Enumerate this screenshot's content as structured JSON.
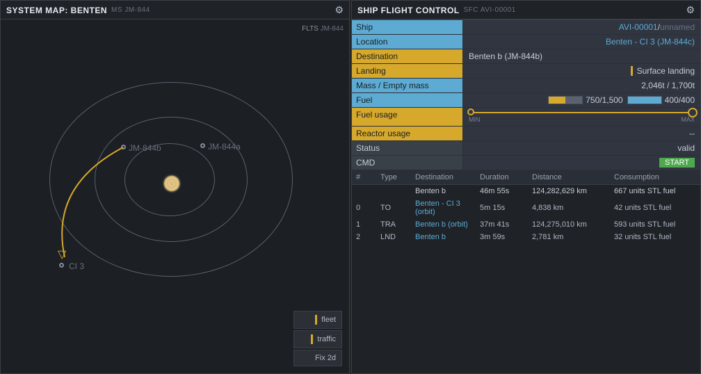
{
  "systemMap": {
    "title": "SYSTEM MAP: BENTEN",
    "sub": "MS JM-844",
    "fltsLabel": "FLTS",
    "fltsVal": "JM-844",
    "bodies": {
      "a": "JM-844a",
      "b": "JM-844b",
      "ci3": "CI 3"
    },
    "toggles": {
      "fleet": "fleet",
      "traffic": "traffic",
      "fix2d": "Fix 2d"
    }
  },
  "flight": {
    "title": "SHIP FLIGHT CONTROL",
    "sub": "SFC AVI-00001",
    "rows": {
      "shipLabel": "Ship",
      "shipId": "AVI-00001",
      "shipSep": " / ",
      "shipName": "unnamed",
      "locLabel": "Location",
      "locVal": "Benten - CI 3 (JM-844c)",
      "destLabel": "Destination",
      "destVal": "Benten b (JM-844b)",
      "landLabel": "Landing",
      "landVal": "Surface landing",
      "massLabel": "Mass / Empty mass",
      "massVal": "2,046t / 1,700t",
      "fuelLabel": "Fuel",
      "fuel1": "750/1,500",
      "fuel2": "400/400",
      "usageLabel": "Fuel usage",
      "usageMin": "MIN",
      "usageMax": "MAX",
      "reactorLabel": "Reactor usage",
      "reactorVal": "--",
      "statusLabel": "Status",
      "statusVal": "valid",
      "cmdLabel": "CMD",
      "cmdBtn": "START"
    },
    "tableHeaders": {
      "idx": "#",
      "type": "Type",
      "dest": "Destination",
      "dur": "Duration",
      "dist": "Distance",
      "cons": "Consumption"
    },
    "routes": [
      {
        "idx": "",
        "type": "",
        "dest": "Benten b",
        "dur": "46m 55s",
        "dist": "124,282,629 km",
        "cons": "667 units STL fuel",
        "summary": true
      },
      {
        "idx": "0",
        "type": "TO",
        "dest": "Benten - CI 3 (orbit)",
        "dur": "5m 15s",
        "dist": "4,838 km",
        "cons": "42 units STL fuel"
      },
      {
        "idx": "1",
        "type": "TRA",
        "dest": "Benten b (orbit)",
        "dur": "37m 41s",
        "dist": "124,275,010 km",
        "cons": "593 units STL fuel"
      },
      {
        "idx": "2",
        "type": "LND",
        "dest": "Benten b",
        "dur": "3m 59s",
        "dist": "2,781 km",
        "cons": "32 units STL fuel"
      }
    ]
  }
}
